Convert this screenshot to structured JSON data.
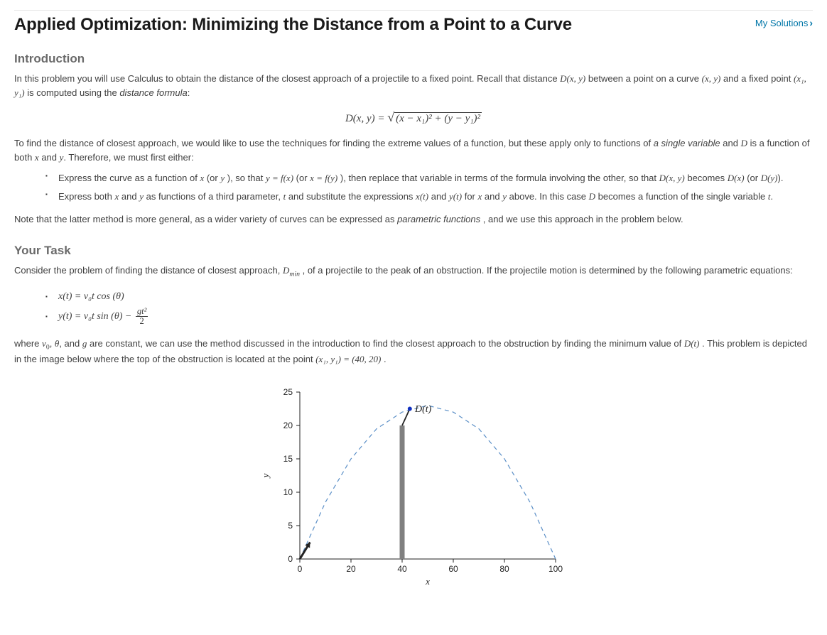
{
  "header": {
    "title": "Applied Optimization: Minimizing the Distance from a Point to a Curve",
    "solutions_link": "My Solutions"
  },
  "intro": {
    "heading": "Introduction",
    "p1a": "In this problem you will use Calculus to obtain the distance of the closest approach of a projectile to a fixed point. Recall that distance ",
    "p1b": " between a point on a curve ",
    "p1c": " and a fixed point ",
    "p1d": " is computed using the ",
    "p1e": "distance formula",
    "p1f": ":",
    "p2a": "To find the distance of closest approach, we would like to use the techniques for finding the extreme values of a function, but these apply only to functions of ",
    "p2b": "a single variable",
    "p2c": " and ",
    "p2d": " is a function of both ",
    "p2e": " and ",
    "p2f": ". Therefore, we must first either:",
    "li1a": "Express the curve as a function of ",
    "li1b": " (or ",
    "li1c": "), so that ",
    "li1d": " (or ",
    "li1e": "), then replace that variable in terms of the formula involving the other, so that ",
    "li1f": " becomes ",
    "li1g": " (or ",
    "li1h": ").",
    "li2a": "Express both ",
    "li2b": " and ",
    "li2c": " as functions of a third parameter, ",
    "li2d": " and substitute the expressions ",
    "li2e": " and ",
    "li2f": " for ",
    "li2g": " and ",
    "li2h": " above. In this case ",
    "li2i": " becomes a function of the single variable ",
    "li2j": ".",
    "p3a": "Note that the latter method is more general, as a wider variety of curves can be expressed as ",
    "p3b": "parametric functions",
    "p3c": ", and we use this approach in the problem below."
  },
  "task": {
    "heading": "Your Task",
    "p1a": "Consider the problem of finding the distance of closest approach, ",
    "p1b": ", of a projectile to the peak of an obstruction. If the projectile motion is determined by the following parametric equations:",
    "p2a": "where ",
    "p2b": " are constant, we can use the method discussed in the introduction to find the closest approach to the obstruction by finding the minimum value of ",
    "p2c": ". This problem is depicted in the image below where the top of the obstruction is located at the point ",
    "p2d": "."
  },
  "math_tokens": {
    "Dxy": "D(x, y)",
    "xy": "(x, y)",
    "x1y1": "(x₁, y₁)",
    "D": "D",
    "x": "x",
    "y": "y",
    "t": "t",
    "yfx": "y = f(x)",
    "xfy": "x = f(y)",
    "Dx": "D(x)",
    "Dy": "D(y)",
    "xt": "x(t)",
    "yt": "y(t)",
    "Dmin_a": "D",
    "Dmin_b": "min",
    "v0_a": "v",
    "v0_b": "0",
    "theta": "θ",
    "g": "g",
    "and": ", and",
    "Dt": "D(t)",
    "point_val": "(x₁, y₁) = (40, 20)",
    "eq1": "x(t) = v₀t cos (θ)",
    "eq2a": "y(t) = v₀t sin (θ) − ",
    "eq2num": "gt²",
    "eq2den": "2",
    "formula_lhs": "D(x, y) = ",
    "formula_rad": "(x − x₁)² + (y − y₁)²"
  },
  "chart_data": {
    "type": "line",
    "title": "",
    "xlabel": "x",
    "ylabel": "y",
    "xlim": [
      0,
      100
    ],
    "ylim": [
      0,
      25
    ],
    "xticks": [
      0,
      20,
      40,
      60,
      80,
      100
    ],
    "yticks": [
      0,
      5,
      10,
      15,
      20,
      25
    ],
    "series": [
      {
        "name": "trajectory",
        "style": "dashed",
        "x": [
          0,
          10,
          20,
          30,
          40,
          50,
          60,
          70,
          80,
          90,
          100
        ],
        "y": [
          0,
          8.5,
          15.0,
          19.5,
          22.0,
          23.0,
          22.0,
          19.5,
          15.0,
          8.5,
          0
        ]
      }
    ],
    "obstruction": {
      "x": 40,
      "y": 20
    },
    "distance_line": {
      "from": [
        40,
        20
      ],
      "to": [
        43,
        22.5
      ]
    },
    "annotation": {
      "text": "D(t)",
      "x": 45,
      "y": 22
    },
    "launch_arrow": {
      "from": [
        0,
        0
      ],
      "to": [
        4,
        2.5
      ]
    }
  }
}
